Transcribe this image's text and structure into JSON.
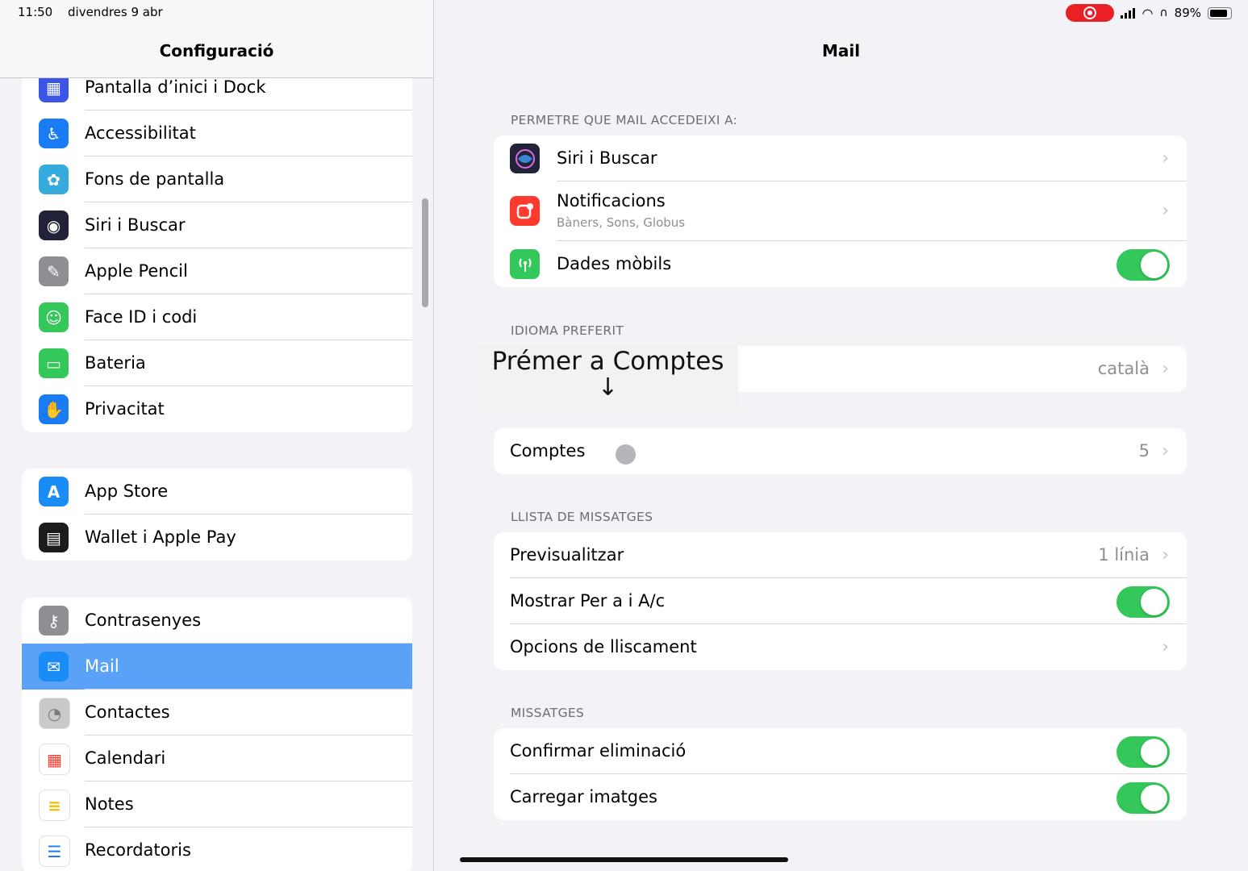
{
  "status": {
    "time": "11:50",
    "date": "divendres 9 abr",
    "battery": "89%"
  },
  "sidebar": {
    "title": "Configuració",
    "groups": [
      [
        {
          "label": "Pantalla d’inici i Dock",
          "icon": "home-screen-icon",
          "color": "#3b55e6"
        },
        {
          "label": "Accessibilitat",
          "icon": "accessibility-icon",
          "color": "#1a7cf5"
        },
        {
          "label": "Fons de pantalla",
          "icon": "wallpaper-flower-icon",
          "color": "#35aadc"
        },
        {
          "label": "Siri i Buscar",
          "icon": "siri-icon",
          "color": "#222238"
        },
        {
          "label": "Apple Pencil",
          "icon": "pencil-icon",
          "color": "#8e8e93"
        },
        {
          "label": "Face ID i codi",
          "icon": "face-id-icon",
          "color": "#34c759"
        },
        {
          "label": "Bateria",
          "icon": "battery-icon",
          "color": "#34c759"
        },
        {
          "label": "Privacitat",
          "icon": "hand-icon",
          "color": "#1a7cf5"
        }
      ],
      [
        {
          "label": "App Store",
          "icon": "app-store-icon",
          "color": "#1a8cf5"
        },
        {
          "label": "Wallet i Apple Pay",
          "icon": "wallet-icon",
          "color": "#1c1c1e"
        }
      ],
      [
        {
          "label": "Contrasenyes",
          "icon": "key-icon",
          "color": "#8e8e93"
        },
        {
          "label": "Mail",
          "icon": "mail-envelope-icon",
          "color": "#1a8cf5"
        },
        {
          "label": "Contactes",
          "icon": "contacts-icon",
          "color": "#c9c9c9"
        },
        {
          "label": "Calendari",
          "icon": "calendar-icon",
          "color": "#ffffff"
        },
        {
          "label": "Notes",
          "icon": "notes-icon",
          "color": "#ffffff"
        },
        {
          "label": "Recordatoris",
          "icon": "reminders-icon",
          "color": "#ffffff"
        }
      ]
    ]
  },
  "detail": {
    "title": "Mail",
    "sec_access": "PERMETRE QUE MAIL ACCEDEIXI A:",
    "siri": "Siri i Buscar",
    "notif": "Notificacions",
    "notif_sub": "Bàners, Sons, Globus",
    "cellular": "Dades mòbils",
    "sec_lang": "IDIOMA PREFERIT",
    "lang_value": "català",
    "accounts": "Comptes",
    "accounts_count": "5",
    "sec_list": "LLISTA DE MISSATGES",
    "preview": "Previsualitzar",
    "preview_value": "1 línia",
    "show_to_cc": "Mostrar Per a i A/c",
    "swipe": "Opcions de lliscament",
    "sec_msgs": "MISSATGES",
    "confirm_delete": "Confirmar eliminació",
    "load_images": "Carregar imatges",
    "colors": {
      "toggle_on": "#34c759",
      "selected": "#5aa2f8"
    }
  },
  "overlay": {
    "text": "Prémer a Comptes",
    "arrow": "↓"
  }
}
